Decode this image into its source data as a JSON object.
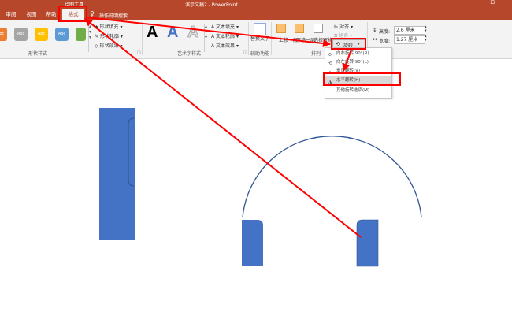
{
  "window": {
    "title": "演示文稿2 - PowerPoint"
  },
  "context_tab": {
    "label": "绘图工具"
  },
  "tabs": [
    {
      "label": "审阅"
    },
    {
      "label": "视图"
    },
    {
      "label": "帮助"
    },
    {
      "label": "格式"
    }
  ],
  "tell_me": {
    "label": "操作说明搜索"
  },
  "ribbon": {
    "shape_styles": {
      "swatch_label": "Abc",
      "fill": "形状填充",
      "outline": "形状轮廓",
      "effects": "形状效果",
      "group_label": "形状样式"
    },
    "wordart": {
      "letter": "A",
      "text_fill": "文本填充",
      "text_outline": "文本轮廓",
      "text_effects": "文本效果",
      "group_label": "艺术字样式"
    },
    "accessibility": {
      "alt_text": "替换文字",
      "group_label": "辅助功能"
    },
    "arrange": {
      "bring_forward": "上移一层",
      "send_backward": "下移一层",
      "selection_pane": "选择窗格",
      "align": "对齐",
      "group": "组合",
      "rotate": "旋转",
      "group_label": "排列"
    },
    "size": {
      "height_label": "高度:",
      "height_value": "2.6 厘米",
      "width_label": "宽度:",
      "width_value": "1.27 厘米"
    }
  },
  "rotate_menu": {
    "items": [
      {
        "label": "向右旋转 90°(R)"
      },
      {
        "label": "向左旋转 90°(L)"
      },
      {
        "label": "垂直翻转(V)"
      },
      {
        "label": "水平翻转(H)"
      },
      {
        "label": "其他旋转选项(M)..."
      }
    ]
  },
  "colors": {
    "accent": "#b7472a",
    "shape_blue": "#4472c4",
    "arc_blue": "#2f5597",
    "annotation_red": "#ff0000"
  }
}
